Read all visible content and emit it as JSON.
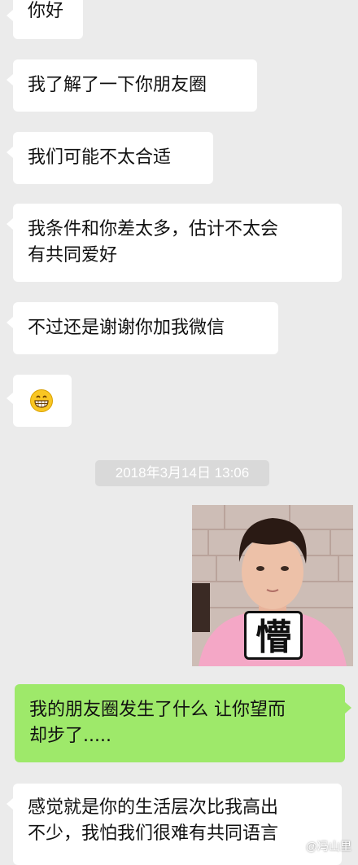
{
  "messages": [
    {
      "side": "left",
      "text": "你好"
    },
    {
      "side": "left",
      "text": "我了解了一下你朋友圈"
    },
    {
      "side": "left",
      "text": "我们可能不太合适"
    },
    {
      "side": "left",
      "text": "我条件和你差太多，估计不太会\n有共同爱好"
    },
    {
      "side": "left",
      "text": "不过还是谢谢你加我微信"
    },
    {
      "side": "left",
      "type": "emoji",
      "icon": "grinning-face-icon"
    },
    {
      "type": "timestamp",
      "text": "2018年3月14日 13:06"
    },
    {
      "side": "right",
      "type": "sticker",
      "caption": "懵"
    },
    {
      "side": "right",
      "text": "我的朋友圈发生了什么 让你望而\n却步了....."
    },
    {
      "side": "left",
      "text": "感觉就是你的生活层次比我高出\n不少，我怕我们很难有共同语言"
    }
  ],
  "watermark": "@冯山里",
  "colors": {
    "background": "#ebebeb",
    "incoming_bubble": "#ffffff",
    "outgoing_bubble": "#9ee96a",
    "timestamp_bg": "#d9d9d9"
  }
}
